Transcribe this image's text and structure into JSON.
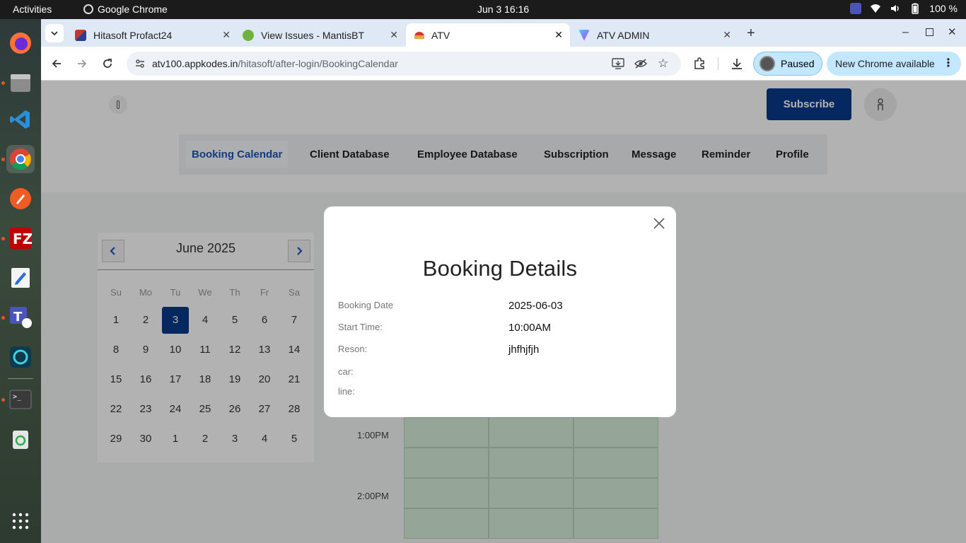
{
  "system": {
    "activities": "Activities",
    "app_name": "Google Chrome",
    "clock": "Jun 3  16:16",
    "battery": "100 %"
  },
  "tabs": [
    {
      "title": "Hitasoft Profact24"
    },
    {
      "title": "View Issues - MantisBT"
    },
    {
      "title": "ATV"
    },
    {
      "title": "ATV ADMIN"
    }
  ],
  "toolbar": {
    "url_host": "atv100.appkodes.in",
    "url_path": "/hitasoft/after-login/BookingCalendar",
    "paused_label": "Paused",
    "update_label": "New Chrome available"
  },
  "page": {
    "subscribe_label": "Subscribe",
    "nav": [
      "Booking Calendar",
      "Client Database",
      "Employee Database",
      "Subscription",
      "Message",
      "Reminder",
      "Profile"
    ],
    "calendar": {
      "month": "June 2025",
      "weekdays": [
        "Su",
        "Mo",
        "Tu",
        "We",
        "Th",
        "Fr",
        "Sa"
      ],
      "weeks": [
        [
          "1",
          "2",
          "3",
          "4",
          "5",
          "6",
          "7"
        ],
        [
          "8",
          "9",
          "10",
          "11",
          "12",
          "13",
          "14"
        ],
        [
          "15",
          "16",
          "17",
          "18",
          "19",
          "20",
          "21"
        ],
        [
          "22",
          "23",
          "24",
          "25",
          "26",
          "27",
          "28"
        ],
        [
          "29",
          "30",
          "1",
          "2",
          "3",
          "4",
          "5"
        ]
      ],
      "selected": "3"
    },
    "times": [
      "1:00PM",
      "2:00PM"
    ]
  },
  "modal": {
    "title": "Booking Details",
    "rows": [
      {
        "label": "Booking Date",
        "value": "2025-06-03"
      },
      {
        "label": "Start Time:",
        "value": "10:00AM"
      },
      {
        "label": "Reson:",
        "value": "jhfhjfjh"
      },
      {
        "label": "car:",
        "value": ""
      },
      {
        "label": "line:",
        "value": ""
      }
    ]
  },
  "colors": {
    "primary": "#0a3a8c",
    "active_nav": "#1d56b8",
    "slot_fill": "#d6eedb"
  }
}
